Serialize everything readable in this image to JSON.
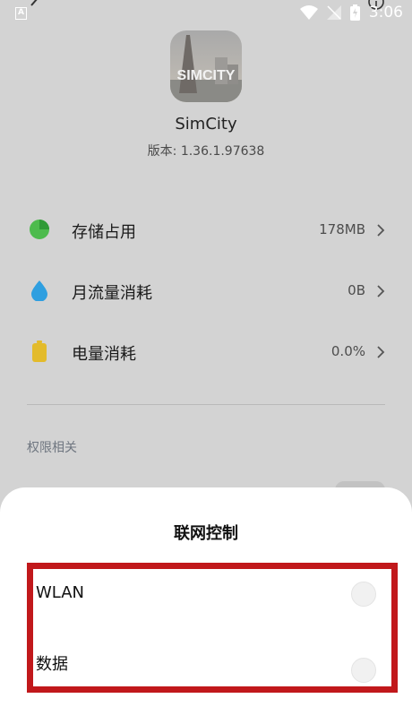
{
  "status_bar": {
    "time": "3:06",
    "a_badge": "A"
  },
  "app": {
    "name": "SimCity",
    "version": "版本: 1.36.1.97638",
    "icon_text": "SIMCITY"
  },
  "rows": [
    {
      "label": "存储占用",
      "value": "178MB",
      "icon": "pie-chart-icon",
      "color": "#4dbb4d"
    },
    {
      "label": "月流量消耗",
      "value": "0B",
      "icon": "water-drop-icon",
      "color": "#2f9fe0"
    },
    {
      "label": "电量消耗",
      "value": "0.0%",
      "icon": "battery-icon",
      "color": "#e3bb2b"
    }
  ],
  "section": {
    "title": "权限相关"
  },
  "sheet": {
    "title": "联网控制",
    "options": [
      {
        "label": "WLAN"
      },
      {
        "label": "数据"
      }
    ]
  },
  "colors": {
    "highlight": "#c1181b",
    "dim_background": "#d3d3d3"
  }
}
